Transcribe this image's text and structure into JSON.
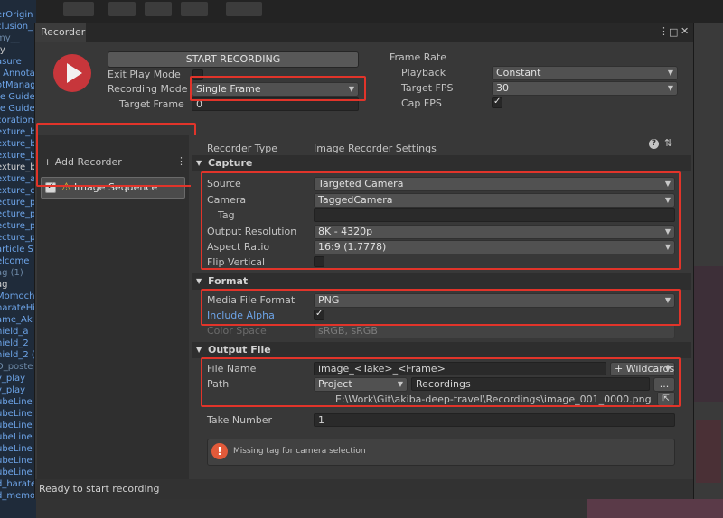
{
  "window": {
    "tab_title": "Recorder"
  },
  "header": {
    "start_button": "START RECORDING",
    "exit_play_mode_label": "Exit Play Mode",
    "recording_mode_label": "Recording Mode",
    "recording_mode_value": "Single Frame",
    "target_frame_label": "Target Frame",
    "target_frame_value": "0",
    "frame_rate_title": "Frame Rate",
    "playback_label": "Playback",
    "playback_value": "Constant",
    "target_fps_label": "Target FPS",
    "target_fps_value": "30",
    "cap_fps_label": "Cap FPS"
  },
  "left_panel": {
    "add_recorder": "+ Add Recorder",
    "menu_icon": "⋮",
    "recorders": [
      {
        "label": "Image Sequence",
        "enabled": true,
        "warning": true
      }
    ]
  },
  "recorder": {
    "type_label": "Recorder Type",
    "type_value": "Image Recorder Settings"
  },
  "capture": {
    "title": "Capture",
    "source_label": "Source",
    "source_value": "Targeted Camera",
    "camera_label": "Camera",
    "camera_value": "TaggedCamera",
    "tag_label": "Tag",
    "tag_value": "",
    "output_resolution_label": "Output Resolution",
    "output_resolution_value": "8K - 4320p",
    "aspect_ratio_label": "Aspect Ratio",
    "aspect_ratio_value": "16:9 (1.7778)",
    "flip_vertical_label": "Flip Vertical"
  },
  "format": {
    "title": "Format",
    "media_file_format_label": "Media File Format",
    "media_file_format_value": "PNG",
    "include_alpha_label": "Include Alpha",
    "color_space_label": "Color Space",
    "color_space_value": "sRGB, sRGB"
  },
  "output_file": {
    "title": "Output File",
    "file_name_label": "File Name",
    "file_name_value": "image_<Take>_<Frame>",
    "wildcards_button": "+ Wildcards",
    "path_label": "Path",
    "path_root_value": "Project",
    "path_value": "Recordings",
    "browse_button": "...",
    "full_path": "E:\\Work\\Git\\akiba-deep-travel\\Recordings\\image_001_0000.png"
  },
  "take_number": {
    "label": "Take Number",
    "value": "1"
  },
  "message": {
    "text": "Missing tag for camera selection"
  },
  "status": {
    "text": "Ready to start recording"
  },
  "background": {
    "hierarchy_items": [
      "erOrigin",
      "clusion_",
      "my__",
      "ty",
      "asure",
      "t Annota",
      "otManag",
      "te Guide",
      "te Guide",
      "corations",
      "exture_b",
      "exture_b",
      "exture_b",
      "exture_b",
      "exture_a",
      "exture_c",
      "ecture_p",
      "ecture_p",
      "ecture_p",
      "ecture_p",
      "article S",
      "elcome",
      "ag (1)",
      "ag",
      "Momochi",
      "harateHi",
      "ame_Ak",
      "hield_a",
      "hield_2",
      "hield_2 (",
      "D_poste",
      "v_play",
      "v_play",
      "ubeLine",
      "ubeLine",
      "ubeLine",
      "ubeLine",
      "ubeLine",
      "ubeLine",
      "ubeLine",
      "d_harate",
      "d_memor"
    ]
  },
  "colors": {
    "accent_red": "#e1342a",
    "record_red": "#c7363b",
    "link_blue": "#6da4e8"
  }
}
